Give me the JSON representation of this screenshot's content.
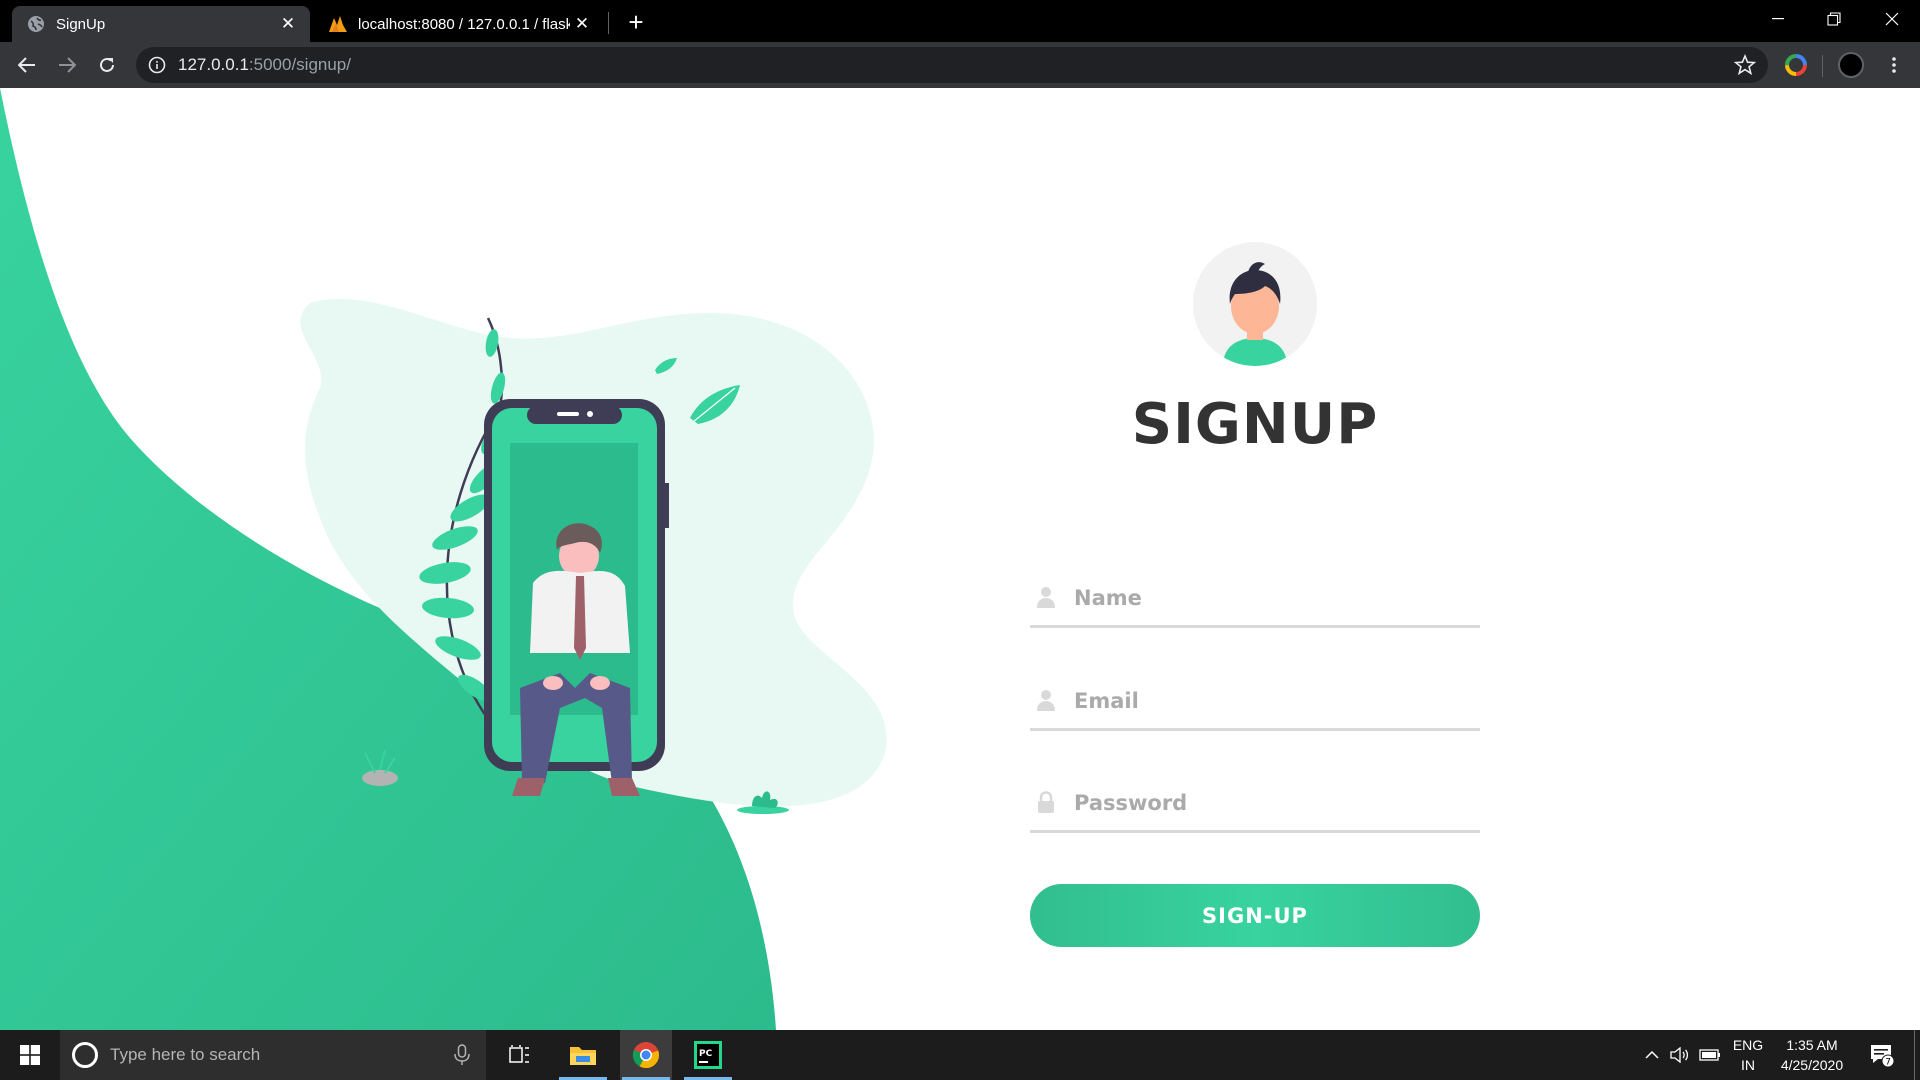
{
  "browser": {
    "tabs": [
      {
        "title": "SignUp",
        "favicon": "globe-icon",
        "active": true
      },
      {
        "title": "localhost:8080 / 127.0.0.1 / flask",
        "favicon": "phpmyadmin-icon",
        "active": false
      }
    ],
    "new_tab_icon": "plus-icon",
    "address": {
      "host": "127.0.0.1",
      "path": ":5000/signup/"
    },
    "icons": [
      "back-icon",
      "forward-icon",
      "reload-icon",
      "info-icon",
      "star-icon",
      "extension-icon",
      "profile-icon",
      "menu-icon"
    ]
  },
  "page": {
    "title": "SIGNUP",
    "fields": {
      "name": {
        "placeholder": "Name",
        "icon": "user-icon"
      },
      "email": {
        "placeholder": "Email",
        "icon": "user-icon"
      },
      "password": {
        "placeholder": "Password",
        "icon": "lock-icon"
      }
    },
    "submit_label": "SIGN-UP",
    "colors": {
      "accent": "#32be8f",
      "accent_light": "#38d39f",
      "title": "#333333",
      "phone": "#3f3d56",
      "blob": "#e8f9f3"
    }
  },
  "taskbar": {
    "search_placeholder": "Type here to search",
    "apps": [
      "task-view-icon",
      "file-explorer-icon",
      "chrome-icon",
      "pycharm-icon"
    ],
    "language": {
      "line1": "ENG",
      "line2": "IN"
    },
    "time": "1:35 AM",
    "date": "4/25/2020",
    "notification_count": "7"
  }
}
